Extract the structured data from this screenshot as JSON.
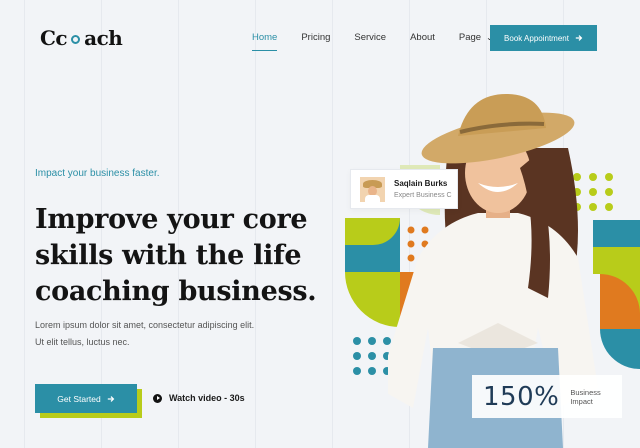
{
  "brand": {
    "logo_prefix": "C",
    "logo_suffix": "ach"
  },
  "nav": {
    "items": [
      {
        "label": "Home",
        "active": true
      },
      {
        "label": "Pricing",
        "active": false
      },
      {
        "label": "Service",
        "active": false
      },
      {
        "label": "About",
        "active": false
      },
      {
        "label": "Page",
        "active": false,
        "dropdown": true
      }
    ],
    "cta_label": "Book Appointment",
    "cta_icon": "arrow-right-icon"
  },
  "hero": {
    "tagline": "Impact your business faster.",
    "headline": "Improve your core skills with the life coaching business.",
    "body": "Lorem ipsum dolor sit amet, consectetur adipiscing elit. Ut elit tellus, luctus nec.",
    "primary_button": "Get Started",
    "video_link": "Watch video - 30s"
  },
  "profile_card": {
    "name": "Saqlain Burks",
    "role": "Expert Business C"
  },
  "stats_card": {
    "value": "150%",
    "label": "Business Impact"
  },
  "colors": {
    "accent": "#2b8fa6",
    "lime": "#b8cc1a",
    "orange": "#e07a1f",
    "navy": "#1f3b57",
    "background": "#f2f4f7"
  }
}
